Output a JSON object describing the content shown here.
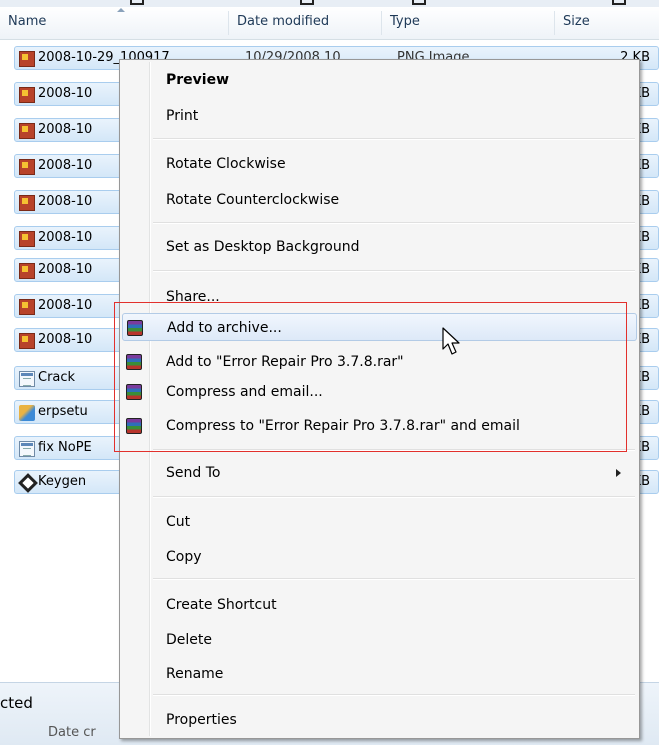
{
  "columns": {
    "name": "Name",
    "date": "Date modified",
    "type": "Type",
    "size": "Size"
  },
  "files": [
    {
      "name": "2008-10-29_100917",
      "date": "10/29/2008 10...",
      "type": "PNG Image",
      "size": "2 KB",
      "icon": "image-icon"
    },
    {
      "name": "2008-10",
      "size": "KB",
      "icon": "image-icon"
    },
    {
      "name": "2008-10",
      "size": "KB",
      "icon": "image-icon"
    },
    {
      "name": "2008-10",
      "size": "KB",
      "icon": "image-icon"
    },
    {
      "name": "2008-10",
      "size": "KB",
      "icon": "image-icon"
    },
    {
      "name": "2008-10",
      "size": "KB",
      "icon": "image-icon"
    },
    {
      "name": "2008-10",
      "size": "KB",
      "icon": "image-icon"
    },
    {
      "name": "2008-10",
      "size": "KB",
      "icon": "image-icon"
    },
    {
      "name": "2008-10",
      "size": "KB",
      "icon": "image-icon"
    },
    {
      "name": "Crack",
      "size": "KB",
      "icon": "document-icon"
    },
    {
      "name": "erpsetu",
      "size": "KB",
      "icon": "setup-icon"
    },
    {
      "name": "fix NoPE",
      "size": "KB",
      "icon": "document-icon"
    },
    {
      "name": "Keygen",
      "size": "KB",
      "icon": "key-icon"
    }
  ],
  "details": {
    "status": "cted",
    "meta": "Date cr"
  },
  "context_menu": {
    "preview": "Preview",
    "print": "Print",
    "rotate_cw": "Rotate Clockwise",
    "rotate_ccw": "Rotate Counterclockwise",
    "set_bg": "Set as Desktop Background",
    "share": "Share...",
    "add_archive": "Add to archive...",
    "add_rar": "Add to \"Error Repair Pro 3.7.8.rar\"",
    "compress_email": "Compress and email...",
    "compress_rar_email": "Compress to \"Error Repair Pro 3.7.8.rar\" and email",
    "send_to": "Send To",
    "cut": "Cut",
    "copy": "Copy",
    "create_shortcut": "Create Shortcut",
    "delete": "Delete",
    "rename": "Rename",
    "properties": "Properties"
  },
  "colors": {
    "highlight_box": "#e2302c",
    "selection": "#d4e7f8",
    "menu_bg": "#f5f5f5"
  }
}
